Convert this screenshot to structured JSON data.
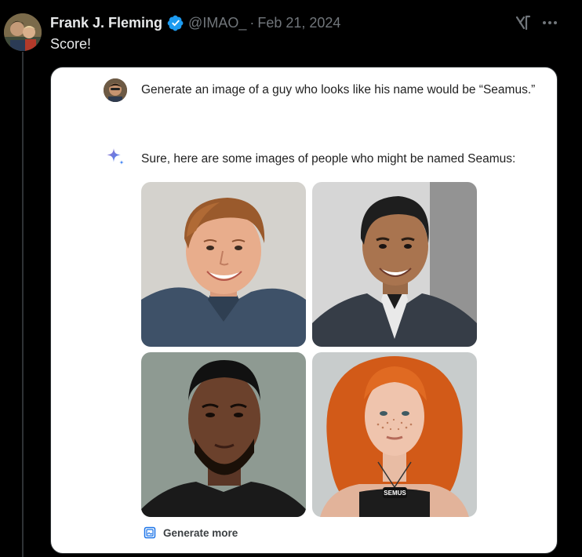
{
  "tweet": {
    "author": {
      "display_name": "Frank J. Fleming",
      "handle": "@IMAO_",
      "verified": true
    },
    "separator": "·",
    "date": "Feb 21, 2024",
    "text": "Score!",
    "actions": {
      "grok_icon": "grok-icon",
      "more_icon": "more-dots-icon"
    }
  },
  "card": {
    "user_prompt": "Generate an image of a guy who looks like his name would be “Seamus.”",
    "response_icon": "gemini-sparkle-icon",
    "response_text": "Sure, here are some images of people who might be named Seamus:",
    "images": [
      "Smiling man with auburn hair in a blue shirt",
      "Smiling man with black hair in a dark suit jacket",
      "Man with short black hair and beard in a black t-shirt",
      "Woman with long curly red hair and freckles wearing a pendant"
    ],
    "pendant_text": "SEMUS",
    "generate_more_label": "Generate more",
    "generate_more_icon": "image-add-icon"
  },
  "colors": {
    "background": "#000000",
    "primary_text": "#e7e9ea",
    "secondary_text": "#71767b",
    "verified_blue": "#1d9bf0",
    "card_background": "#ffffff",
    "card_text": "#1f1f1f",
    "gemini_blue": "#4285f4"
  }
}
